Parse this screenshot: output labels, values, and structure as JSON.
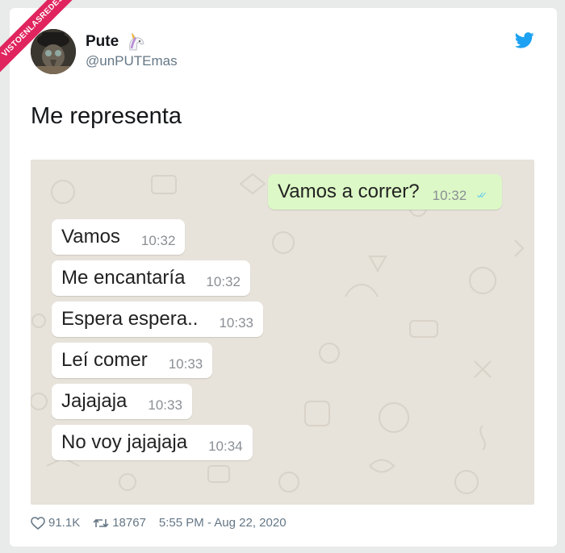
{
  "watermark": {
    "text": "VISTOENLASREDES"
  },
  "author": {
    "name": "Pute",
    "name_emoji": "unicorn-icon",
    "handle": "@unPUTEmas",
    "avatar": "avatar-image"
  },
  "platform_icon": "twitter-bird-icon",
  "tweet": {
    "text": "Me representa"
  },
  "chat": {
    "colors": {
      "incoming": "#ffffff",
      "outgoing": "#dcf8c6",
      "read_ticks": "#4fc3f7",
      "background": "#e7e2da"
    },
    "messages": [
      {
        "direction": "outgoing",
        "text": "Vamos a correr?",
        "time": "10:32",
        "status": "read-ticks-icon"
      },
      {
        "direction": "incoming",
        "text": "Vamos",
        "time": "10:32"
      },
      {
        "direction": "incoming",
        "text": "Me encantaría",
        "time": "10:32"
      },
      {
        "direction": "incoming",
        "text": "Espera espera..",
        "time": "10:33"
      },
      {
        "direction": "incoming",
        "text": "Leí comer",
        "time": "10:33"
      },
      {
        "direction": "incoming",
        "text": "Jajajaja",
        "time": "10:33"
      },
      {
        "direction": "incoming",
        "text": "No voy jajajaja",
        "time": "10:34"
      }
    ]
  },
  "stats": {
    "likes": "91.1K",
    "likes_icon": "heart-icon",
    "retweets": "18767",
    "retweets_icon": "retweet-icon",
    "timestamp": "5:55 PM - Aug 22, 2020"
  }
}
